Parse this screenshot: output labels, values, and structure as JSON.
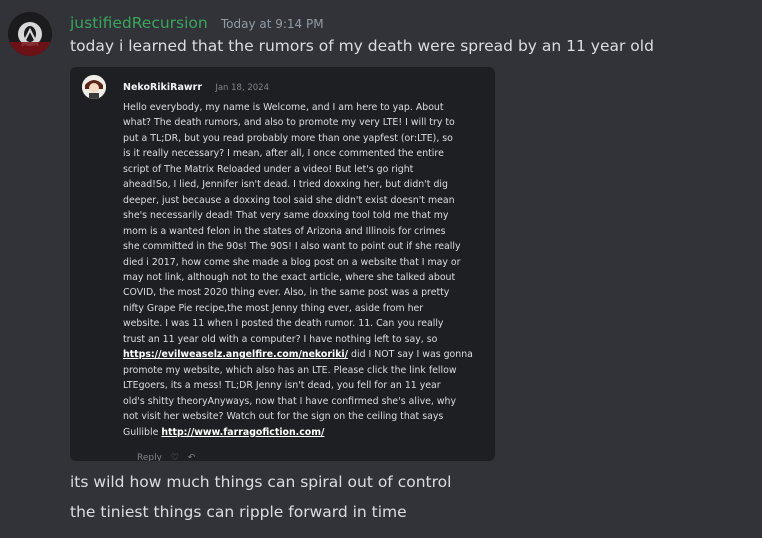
{
  "message": {
    "username": "justifiedRecursion",
    "timestamp": "Today at 9:14 PM",
    "text": "today i learned that the rumors of my death were spread by an 11 year old"
  },
  "embed": {
    "author": "NekoRikiRawrr",
    "date": "Jan 18, 2024",
    "lines": [
      "Hello everybody, my name is Welcome, and I am here to yap. About",
      "what? The death rumors, and also to promote my very LTE! I will try to",
      "put a TL;DR, but you read probably more than one yapfest (or:LTE), so",
      "is it really necessary? I mean, after all, I once commented the entire",
      "script of The Matrix Reloaded under a video! But let's go right",
      "ahead!So, I lied, Jennifer isn't dead. I tried doxxing her, but didn't dig",
      "deeper,  just because a doxxing tool said she didn't exist doesn't mean",
      "she's necessarily dead! That very same doxxing tool told me that my",
      "mom is a wanted felon in the states of Arizona and Illinois for crimes",
      "she committed in the 90s! The 90S! I also want to point out if she really",
      "died i 2017, how come she made a blog post on a website that I may or",
      "may not link, although not to the exact article, where she talked about",
      "COVID, the most 2020 thing ever. Also, in the same post was a pretty",
      "nifty Grape Pie recipe,the most Jenny thing ever, aside from her",
      "website. I was 11 when I posted the death rumor. 11. Can you really",
      "trust an 11 year old with a computer? I have nothing left to say, so"
    ],
    "link1": "https://evilweaselz.angelfire.com/nekoriki/",
    "link1_after": " did I NOT say I was gonna",
    "lines2": [
      "promote my website, which also has an LTE. Please click the link fellow",
      "LTEgoers, its a mess! TL;DR Jenny isn't dead, you fell for an 11 year",
      "old's shitty theoryAnyways, now that I have confirmed she's alive, why",
      "not visit her website? Watch out for the sign on the ceiling that says"
    ],
    "last_prefix": "Gullible ",
    "link2": "http://www.farragofiction.com/",
    "reply_label": "Reply"
  },
  "followups": [
    "its wild how much things can spiral out of control",
    "the tiniest things can ripple forward in time"
  ]
}
